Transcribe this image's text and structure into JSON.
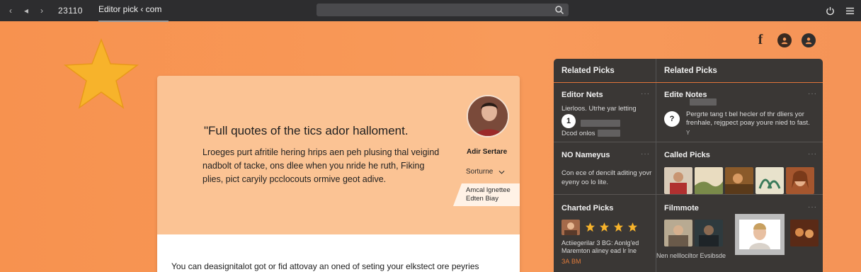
{
  "browser": {
    "tab_number": "23110",
    "tab_title": "Editor pick ‹ com"
  },
  "colors": {
    "page_accent": "#f7924f",
    "card_bg": "#fbc394",
    "panel_bg": "#3a3735",
    "star": "#f7b32b",
    "panel_divider": "#e0743a"
  },
  "main_card": {
    "quote": "\"Full quotes of the tics ador halloment.",
    "body": "Lroeges purt afritile hering hrips aen peh plusing thal veigind nadbolt of tacke, ons dlee when you nride he ruth, Fiking plies, pict caryily pcclocouts ormive geot adive.",
    "author_name": "Adir Sertare",
    "selector_label": "Sorturne",
    "note_line1": "Amcal lgnettee",
    "note_line2": "Edten Biay",
    "footer_text": "You can deasignitalot got or fid attovay an oned of seting your elkstect ore peyries"
  },
  "panel": {
    "header_left": "Related Picks",
    "header_right": "Related Picks",
    "left": {
      "editor_nets": {
        "title": "Editor Nets",
        "line1": "Lierloos. Utrhe yar letting",
        "badge": "1",
        "line2": "Dcod onlos"
      },
      "no_nameyus": {
        "title": "NO Nameyus",
        "text": "Con ece of dencilt aditing yovr eyeny oo lo lite."
      },
      "charted_picks": {
        "title": "Charted Picks",
        "rating": 4,
        "text": "Actiiegerilar 3 BG: Aonlg'ed Maremton aliney ead lr lne",
        "text_extra": "ЗА ВМ"
      }
    },
    "right": {
      "editre_notes": {
        "title": "Edite Notes",
        "badge": "?",
        "text": "Pergrte tang t bel hecler of thr dliers yor frenhale, rejgpect poay youre nied to fast.",
        "text_extra": "Y"
      },
      "called_picks": {
        "title": "Called Picks"
      },
      "filmmote": {
        "title": "Filmmote",
        "caption": "Nen nelllociltor Evsibsde"
      }
    }
  }
}
